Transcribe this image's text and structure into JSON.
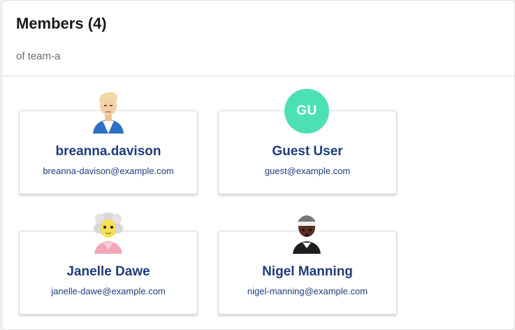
{
  "header": {
    "title": "Members (4)",
    "subtitle": "of team-a"
  },
  "members": [
    {
      "name": "breanna.davison",
      "email": "breanna-davison@example.com",
      "avatar": "avatar-blonde-person-icon"
    },
    {
      "name": "Guest User",
      "email": "guest@example.com",
      "avatar_initials": "GU",
      "avatar_color": "#4de0b4"
    },
    {
      "name": "Janelle Dawe",
      "email": "janelle-dawe@example.com",
      "avatar": "avatar-curly-gray-hair-person-icon"
    },
    {
      "name": "Nigel Manning",
      "email": "nigel-manning@example.com",
      "avatar": "avatar-headband-person-icon"
    }
  ],
  "colors": {
    "name_text": "#1f3c7a",
    "title_text": "#1a1a1a",
    "subtitle_text": "#6b6b6b"
  }
}
